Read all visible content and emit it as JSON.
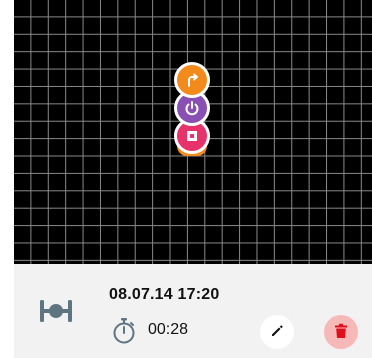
{
  "map": {
    "markers": [
      {
        "name": "turn-right-icon",
        "color": "#f28a1c"
      },
      {
        "name": "power-icon",
        "color": "#8a4fb3"
      },
      {
        "name": "stop-icon",
        "color": "#e6336b"
      }
    ]
  },
  "record": {
    "activity_icon": "dumbbell-icon",
    "date_time": "08.07.14 17:20",
    "timer_icon": "stopwatch-icon",
    "duration": "00:28"
  },
  "actions": {
    "edit_icon": "pencil-icon",
    "delete_icon": "trash-icon",
    "delete_color": "#e0101b"
  }
}
